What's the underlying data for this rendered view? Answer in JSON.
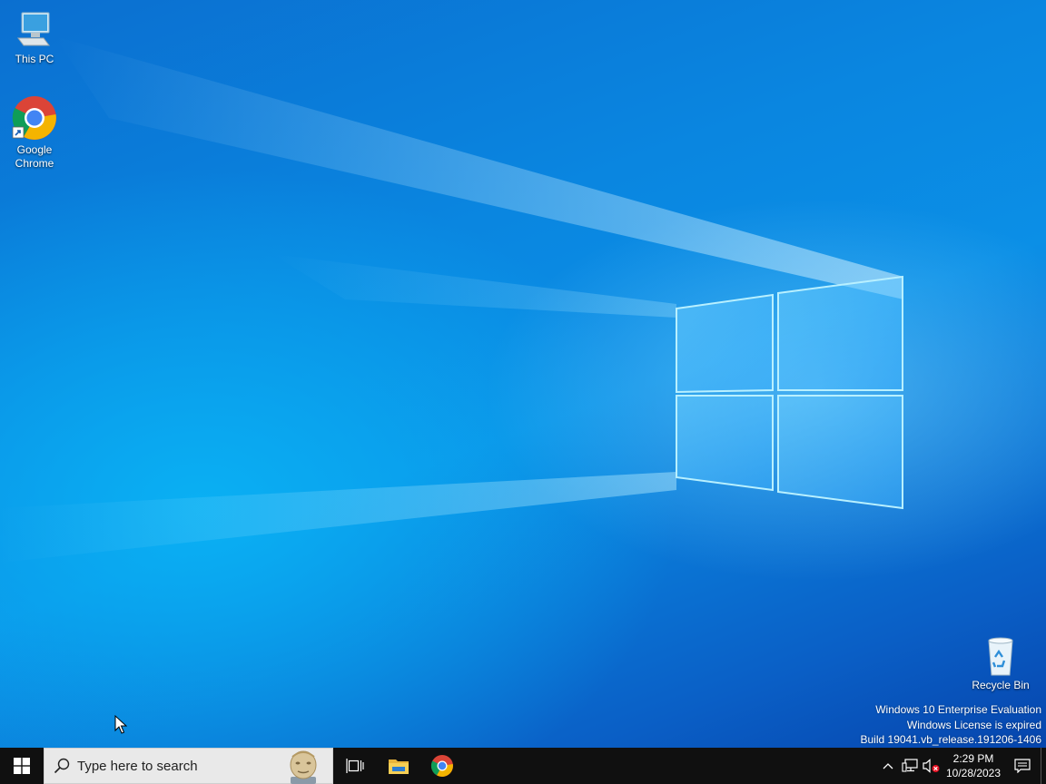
{
  "desktop": {
    "icons": [
      {
        "label": "This PC",
        "icon": "this-pc-icon"
      },
      {
        "label": "Google Chrome",
        "icon": "chrome-icon"
      },
      {
        "label": "Recycle Bin",
        "icon": "recycle-bin-icon"
      }
    ],
    "watermark": {
      "line1": "Windows 10 Enterprise Evaluation",
      "line2": "Windows License is expired",
      "line3": "Build 19041.vb_release.191206-1406"
    }
  },
  "taskbar": {
    "search_placeholder": "Type here to search",
    "pinned": [
      {
        "name": "task-view",
        "icon": "task-view-icon"
      },
      {
        "name": "file-explorer",
        "icon": "folder-icon"
      },
      {
        "name": "chrome",
        "icon": "chrome-icon"
      }
    ],
    "tray": {
      "time": "2:29 PM",
      "date": "10/28/2023",
      "icons": [
        "chevron-up-icon",
        "network-icon",
        "volume-muted-icon",
        "notification-icon"
      ]
    }
  },
  "colors": {
    "taskbar_bg": "#101010",
    "search_bg": "#e9e9e9",
    "accent": "#0a78d4"
  }
}
